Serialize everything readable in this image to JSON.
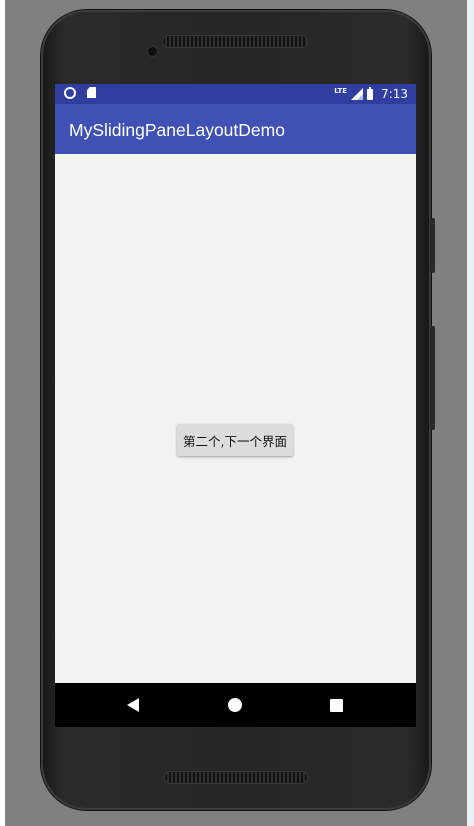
{
  "status_bar": {
    "network_label": "LTE",
    "time": "7:13",
    "icons": [
      "notification-circle-icon",
      "sd-card-icon",
      "signal-icon",
      "battery-icon"
    ]
  },
  "app_bar": {
    "title": "MySlidingPaneLayoutDemo"
  },
  "main": {
    "button_label": "第二个,下一个界面"
  },
  "nav_bar": {
    "icons": [
      "back-icon",
      "home-icon",
      "recents-icon"
    ]
  },
  "colors": {
    "status_bar": "#303f9f",
    "app_bar": "#3f51b5",
    "background": "#f2f2f2",
    "button": "#dcdcdc"
  }
}
